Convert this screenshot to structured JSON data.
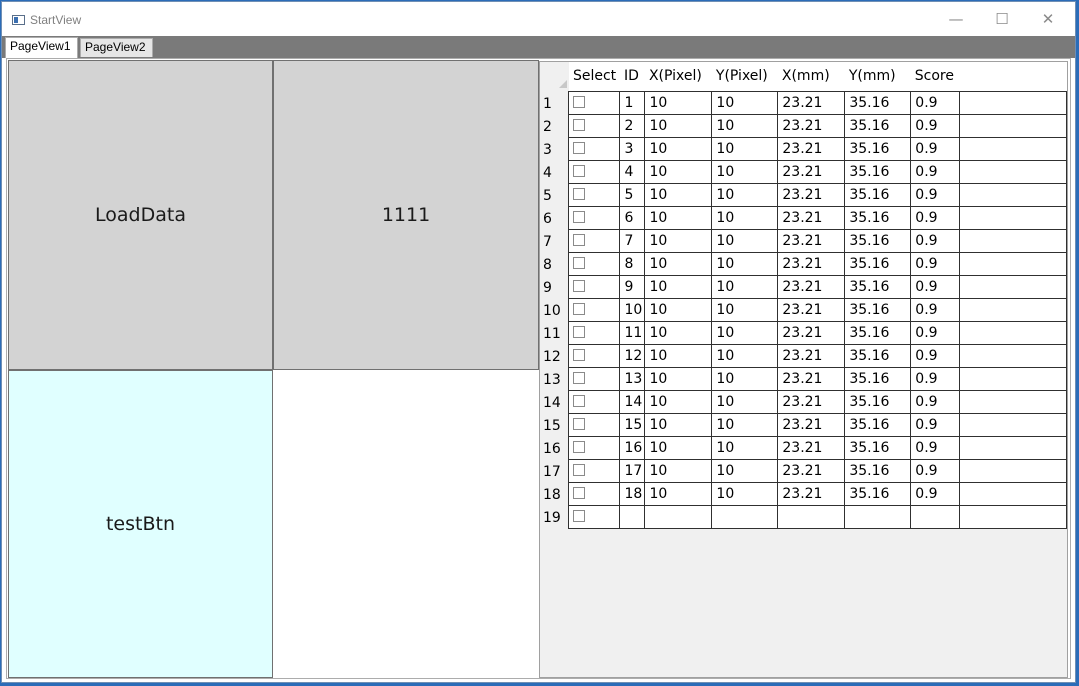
{
  "window": {
    "title": "StartView",
    "minimize_glyph": "—",
    "maximize_glyph": "☐",
    "close_glyph": "✕"
  },
  "tabs": [
    {
      "label": "PageView1"
    },
    {
      "label": "PageView2"
    }
  ],
  "buttons": {
    "load_data": "LoadData",
    "btn_1111": "1111",
    "test_btn": "testBtn"
  },
  "colors": {
    "button_gray": "#d3d3d3",
    "button_lightcyan": "#e0ffff",
    "accent": "#2b6cb8"
  },
  "grid": {
    "columns": [
      "Select",
      "ID",
      "X(Pixel)",
      "Y(Pixel)",
      "X(mm)",
      "Y(mm)",
      "Score"
    ],
    "rows": [
      {
        "num": "1",
        "id": "1",
        "xp": "10",
        "yp": "10",
        "xmm": "23.21",
        "ymm": "35.16",
        "score": "0.9"
      },
      {
        "num": "2",
        "id": "2",
        "xp": "10",
        "yp": "10",
        "xmm": "23.21",
        "ymm": "35.16",
        "score": "0.9"
      },
      {
        "num": "3",
        "id": "3",
        "xp": "10",
        "yp": "10",
        "xmm": "23.21",
        "ymm": "35.16",
        "score": "0.9"
      },
      {
        "num": "4",
        "id": "4",
        "xp": "10",
        "yp": "10",
        "xmm": "23.21",
        "ymm": "35.16",
        "score": "0.9"
      },
      {
        "num": "5",
        "id": "5",
        "xp": "10",
        "yp": "10",
        "xmm": "23.21",
        "ymm": "35.16",
        "score": "0.9"
      },
      {
        "num": "6",
        "id": "6",
        "xp": "10",
        "yp": "10",
        "xmm": "23.21",
        "ymm": "35.16",
        "score": "0.9"
      },
      {
        "num": "7",
        "id": "7",
        "xp": "10",
        "yp": "10",
        "xmm": "23.21",
        "ymm": "35.16",
        "score": "0.9"
      },
      {
        "num": "8",
        "id": "8",
        "xp": "10",
        "yp": "10",
        "xmm": "23.21",
        "ymm": "35.16",
        "score": "0.9"
      },
      {
        "num": "9",
        "id": "9",
        "xp": "10",
        "yp": "10",
        "xmm": "23.21",
        "ymm": "35.16",
        "score": "0.9"
      },
      {
        "num": "10",
        "id": "10",
        "xp": "10",
        "yp": "10",
        "xmm": "23.21",
        "ymm": "35.16",
        "score": "0.9"
      },
      {
        "num": "11",
        "id": "11",
        "xp": "10",
        "yp": "10",
        "xmm": "23.21",
        "ymm": "35.16",
        "score": "0.9"
      },
      {
        "num": "12",
        "id": "12",
        "xp": "10",
        "yp": "10",
        "xmm": "23.21",
        "ymm": "35.16",
        "score": "0.9"
      },
      {
        "num": "13",
        "id": "13",
        "xp": "10",
        "yp": "10",
        "xmm": "23.21",
        "ymm": "35.16",
        "score": "0.9"
      },
      {
        "num": "14",
        "id": "14",
        "xp": "10",
        "yp": "10",
        "xmm": "23.21",
        "ymm": "35.16",
        "score": "0.9"
      },
      {
        "num": "15",
        "id": "15",
        "xp": "10",
        "yp": "10",
        "xmm": "23.21",
        "ymm": "35.16",
        "score": "0.9"
      },
      {
        "num": "16",
        "id": "16",
        "xp": "10",
        "yp": "10",
        "xmm": "23.21",
        "ymm": "35.16",
        "score": "0.9"
      },
      {
        "num": "17",
        "id": "17",
        "xp": "10",
        "yp": "10",
        "xmm": "23.21",
        "ymm": "35.16",
        "score": "0.9"
      },
      {
        "num": "18",
        "id": "18",
        "xp": "10",
        "yp": "10",
        "xmm": "23.21",
        "ymm": "35.16",
        "score": "0.9"
      },
      {
        "num": "19",
        "id": "",
        "xp": "",
        "yp": "",
        "xmm": "",
        "ymm": "",
        "score": ""
      }
    ]
  }
}
